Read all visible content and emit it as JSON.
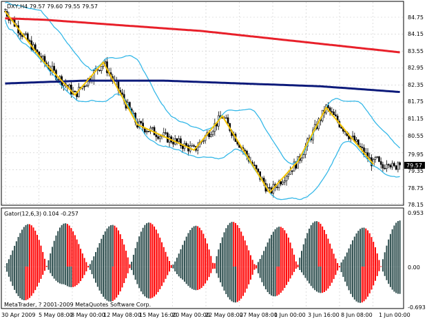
{
  "colors": {
    "background": "#ffffff",
    "grid": "#c8c8c8",
    "frame": "#000000",
    "bull_candle": "#ffffff",
    "bear_candle": "#000000",
    "ma_slow": "#e8202a",
    "ma_medium": "#0c1a7a",
    "bands": "#35b8e8",
    "zigzag": "#f5c400",
    "gator_up": "#ff0000",
    "gator_down": "#2f4f4f",
    "price_marker_bg": "#000000",
    "price_marker_text": "#ffffff"
  },
  "main_chart": {
    "title": "_DXY,H4  79.57 79.60 79.55 79.57",
    "price_axis": [
      "84.75",
      "84.15",
      "83.55",
      "82.95",
      "82.35",
      "81.75",
      "81.15",
      "80.55",
      "79.95",
      "79.35",
      "78.75",
      "78.15"
    ],
    "current_price": "79.57",
    "ylim": [
      78.0,
      85.1
    ]
  },
  "indicator": {
    "title": "Gator(12,6,3) 0.104 -0.257",
    "axis": [
      "0.953",
      "0.00",
      "-0.693"
    ],
    "ylim": [
      -0.693,
      0.953
    ]
  },
  "copyright": "MetaTrader, ? 2001-2009 MetaQuotes Software Corp.",
  "time_axis": [
    "30 Apr 2009",
    "5 May 08:00",
    "8 May 00:00",
    "12 May 08:00",
    "15 May 16:00",
    "20 May 00:00",
    "22 May 08:00",
    "27 May 08:00",
    "1 Jun 00:00",
    "3 Jun 16:00",
    "8 Jun 08:00",
    "1 Jun 00:00"
  ],
  "chart_data": {
    "type": "line",
    "title": "_DXY,H4  79.57 79.60 79.55 79.57",
    "ylim": [
      78.0,
      85.1
    ],
    "zigzag": [
      {
        "i": 0,
        "v": 84.8
      },
      {
        "i": 20,
        "v": 83.05
      },
      {
        "i": 37,
        "v": 81.85
      },
      {
        "i": 52,
        "v": 83.0
      },
      {
        "i": 70,
        "v": 80.8
      },
      {
        "i": 100,
        "v": 79.9
      },
      {
        "i": 115,
        "v": 81.1
      },
      {
        "i": 140,
        "v": 78.4
      },
      {
        "i": 155,
        "v": 79.5
      },
      {
        "i": 170,
        "v": 81.4
      },
      {
        "i": 195,
        "v": 79.4
      }
    ],
    "ma_slow": [
      84.55,
      84.5,
      84.4,
      84.3,
      84.2,
      84.1,
      83.95,
      83.8,
      83.65,
      83.5,
      83.35
    ],
    "ma_medium": [
      82.25,
      82.3,
      82.35,
      82.35,
      82.35,
      82.3,
      82.25,
      82.2,
      82.15,
      82.05,
      81.95
    ],
    "gator_upper_color_pattern": "red-green alternating histogram",
    "gator_range": [
      -0.693,
      0.953
    ]
  }
}
